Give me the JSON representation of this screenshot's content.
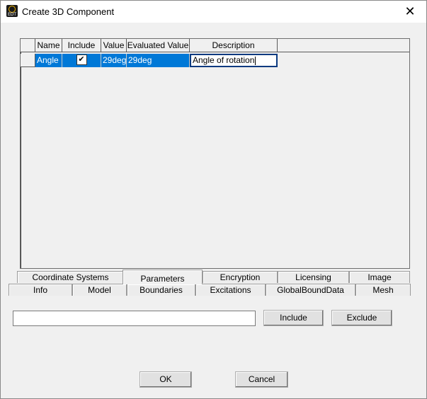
{
  "window": {
    "title": "Create 3D Component",
    "icon_text": "EDT",
    "close_glyph": "✕"
  },
  "grid": {
    "columns": [
      "Name",
      "Include",
      "Value",
      "Evaluated Value",
      "Description"
    ],
    "rows": [
      {
        "name": "Angle",
        "include_checked": true,
        "include_glyph": "✔",
        "value": "29deg",
        "evaluated_value": "29deg",
        "description": "Angle of rotation"
      }
    ]
  },
  "tabs": {
    "top_row": [
      "Coordinate Systems",
      "Parameters",
      "Encryption",
      "Licensing",
      "Image"
    ],
    "bottom_row": [
      "Info",
      "Model",
      "Boundaries",
      "Excitations",
      "GlobalBoundData",
      "Mesh"
    ],
    "active": "Parameters"
  },
  "filter": {
    "value": "",
    "include_label": "Include",
    "exclude_label": "Exclude"
  },
  "buttons": {
    "ok": "OK",
    "cancel": "Cancel"
  },
  "colors": {
    "selection": "#0078d7",
    "background": "#f0f0f0"
  }
}
